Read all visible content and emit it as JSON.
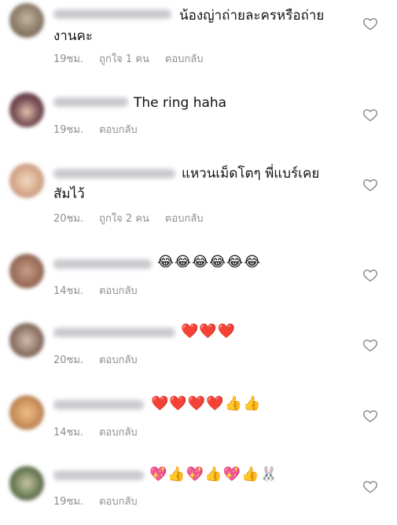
{
  "comments": [
    {
      "text": "น้องญ่าถ่ายละครหรือถ่าย",
      "text2": "งานคะ",
      "time": "19ชม.",
      "likes": "ถูกใจ 1 คน",
      "reply": "ตอบกลับ"
    },
    {
      "text": "The ring haha",
      "time": "19ชม.",
      "reply": "ตอบกลับ"
    },
    {
      "text": "แหวนเม็ดโตๆ พี่แบร์เคย",
      "text2": "สัมไว้",
      "time": "20ชม.",
      "likes": "ถูกใจ 2 คน",
      "reply": "ตอบกลับ"
    },
    {
      "text": "😂😂😂😂😂😂",
      "time": "14ชม.",
      "reply": "ตอบกลับ"
    },
    {
      "text": "❤️❤️❤️",
      "time": "20ชม.",
      "reply": "ตอบกลับ"
    },
    {
      "text": "❤️❤️❤️❤️👍👍",
      "time": "14ชม.",
      "reply": "ตอบกลับ"
    },
    {
      "text": "💖👍💖👍💖👍🐰",
      "time": "19ชม.",
      "reply": "ตอบกลับ"
    }
  ]
}
